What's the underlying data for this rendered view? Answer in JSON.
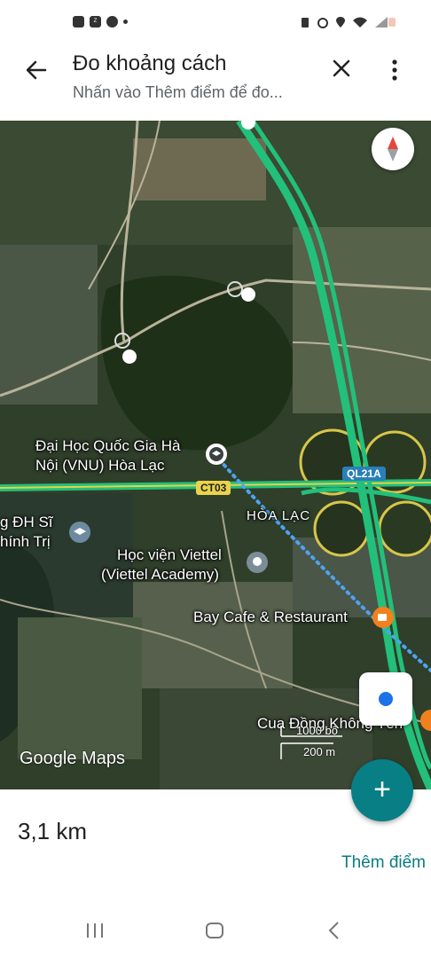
{
  "header": {
    "title": "Đo khoảng cách",
    "subtitle": "Nhấn vào Thêm điểm để đo..."
  },
  "status_bar": {
    "apps": [
      "zalo-icon",
      "messenger-icon"
    ]
  },
  "map": {
    "labels": {
      "vnu_line1": "Đại Học Quốc Gia Hà",
      "vnu_line2": "Nội (VNU) Hòa Lạc",
      "dh_line1": "g ĐH Sĩ",
      "dh_line2": "hính Trị",
      "viettel_line1": "Học viện Viettel",
      "viettel_line2": "(Viettel Academy)",
      "hoa_lac": "HÒA LẠC",
      "bay_cafe": "Bay Cafe & Restaurant",
      "cua_dong": "Cua Đồng Không Tên"
    },
    "road_tags": {
      "ct03": "CT03",
      "ql21a": "QL21A"
    },
    "scale": {
      "top": "1000 bộ",
      "bottom": "200 m"
    },
    "attribution": "Google Maps",
    "colors": {
      "highway": "#22c07a",
      "measure_line": "#4ea3f2",
      "pin_orange": "#f2801c"
    }
  },
  "measurement": {
    "distance": "3,1 km",
    "add_point_label": "Thêm điểm"
  },
  "icons": {
    "back": "back-arrow-icon",
    "close": "close-icon",
    "more": "more-vert-icon",
    "compass": "compass-icon",
    "my_location": "my-location-icon",
    "add": "add-icon"
  }
}
